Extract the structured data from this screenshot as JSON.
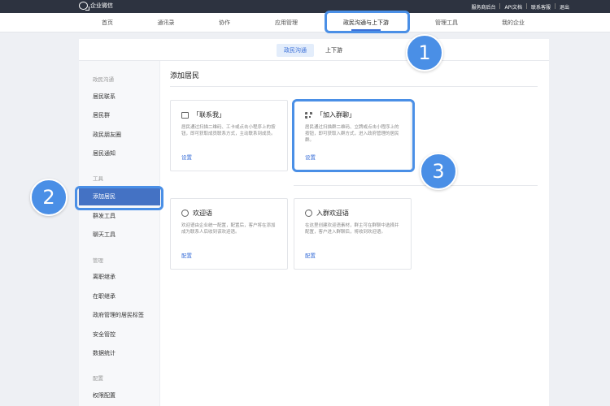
{
  "header": {
    "logo_text": "企业微信",
    "links": [
      "服务商后台",
      "API文档",
      "联系客服",
      "退出"
    ]
  },
  "nav": {
    "items": [
      "首页",
      "通讯录",
      "协作",
      "应用管理",
      "政民沟通与上下游",
      "管理工具",
      "我的企业"
    ],
    "active_index": 4
  },
  "subtabs": {
    "items": [
      "政民沟通",
      "上下游"
    ],
    "active_index": 0
  },
  "sidebar": {
    "groups": [
      {
        "title": "政民沟通",
        "items": [
          "居民联系",
          "居民群",
          "政民朋友圈",
          "居民通知"
        ]
      },
      {
        "title": "工具",
        "items": [
          "添加居民",
          "群发工具",
          "聊天工具"
        ]
      },
      {
        "title": "管理",
        "items": [
          "离职继承",
          "在职继承",
          "政府管理的居民标签",
          "安全管控",
          "数据统计"
        ]
      },
      {
        "title": "配置",
        "items": [
          "权限配置"
        ]
      }
    ],
    "active_item": "添加居民"
  },
  "main": {
    "title": "添加居民",
    "cards": [
      {
        "title": "「联系我」",
        "icon": "chat-icon",
        "desc": "居民通过扫描二维码、工卡或点击小程序上的按钮，即可获取成员联系方式，主动联系到成员。",
        "link": "设置"
      },
      {
        "title": "「加入群聊」",
        "icon": "qr-code-icon",
        "desc": "居民通过扫描群二维码、立牌或点击小程序上的按钮，即可获取入群方式，进入政府管理的居民群。",
        "link": "设置"
      },
      {
        "title": "欢迎语",
        "icon": "greeting-icon",
        "desc": "欢迎语由企业统一配置，配置后，客户将在添加成为联系人后收到该欢迎语。",
        "link": "配置"
      },
      {
        "title": "入群欢迎语",
        "icon": "group-greeting-icon",
        "desc": "在这里创建欢迎语素材，群主可在群聊中选择并配置，客户进入群聊后，将收到欢迎语。",
        "link": "配置"
      }
    ]
  },
  "annotations": {
    "badges": [
      "1",
      "2",
      "3"
    ],
    "color": "#4a8fe6"
  }
}
